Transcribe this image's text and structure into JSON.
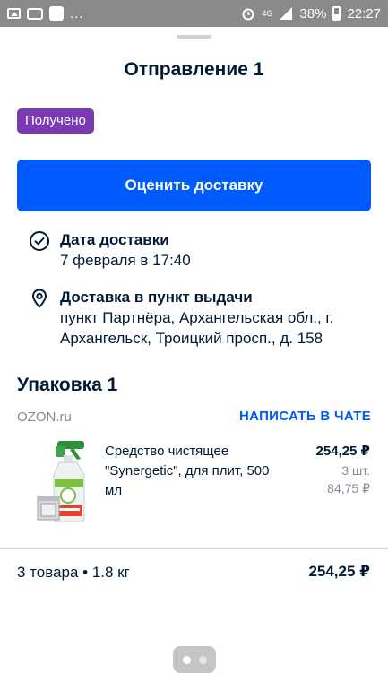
{
  "status_bar": {
    "dots": "...",
    "network": "4G",
    "battery": "38%",
    "time": "22:27"
  },
  "sheet": {
    "title": "Отправление 1",
    "status_badge": "Получено",
    "status_badge_color": "#7a3ab3",
    "rate_button": "Оценить доставку",
    "accent_color": "#005bff",
    "delivery_date": {
      "icon": "check-circle-icon",
      "label": "Дата доставки",
      "value": "7 февраля в 17:40"
    },
    "pickup": {
      "icon": "map-pin-icon",
      "label": "Доставка в пункт выдачи",
      "value": "пункт Партнёра, Архангельская обл., г. Архангельск, Троицкий просп., д. 158"
    }
  },
  "package": {
    "title": "Упаковка 1",
    "seller": "OZON.ru",
    "chat_link": "НАПИСАТЬ В ЧАТЕ",
    "items": [
      {
        "name": "Средство чистящее \"Synergetic\", для плит, 500 мл",
        "price": "254,25 ₽",
        "quantity": "3 шт.",
        "unit_price": "84,75 ₽"
      }
    ]
  },
  "summary": {
    "text": "3 товара • 1.8 кг",
    "total": "254,25 ₽"
  },
  "pager": {
    "pages": 2,
    "current": 1
  }
}
